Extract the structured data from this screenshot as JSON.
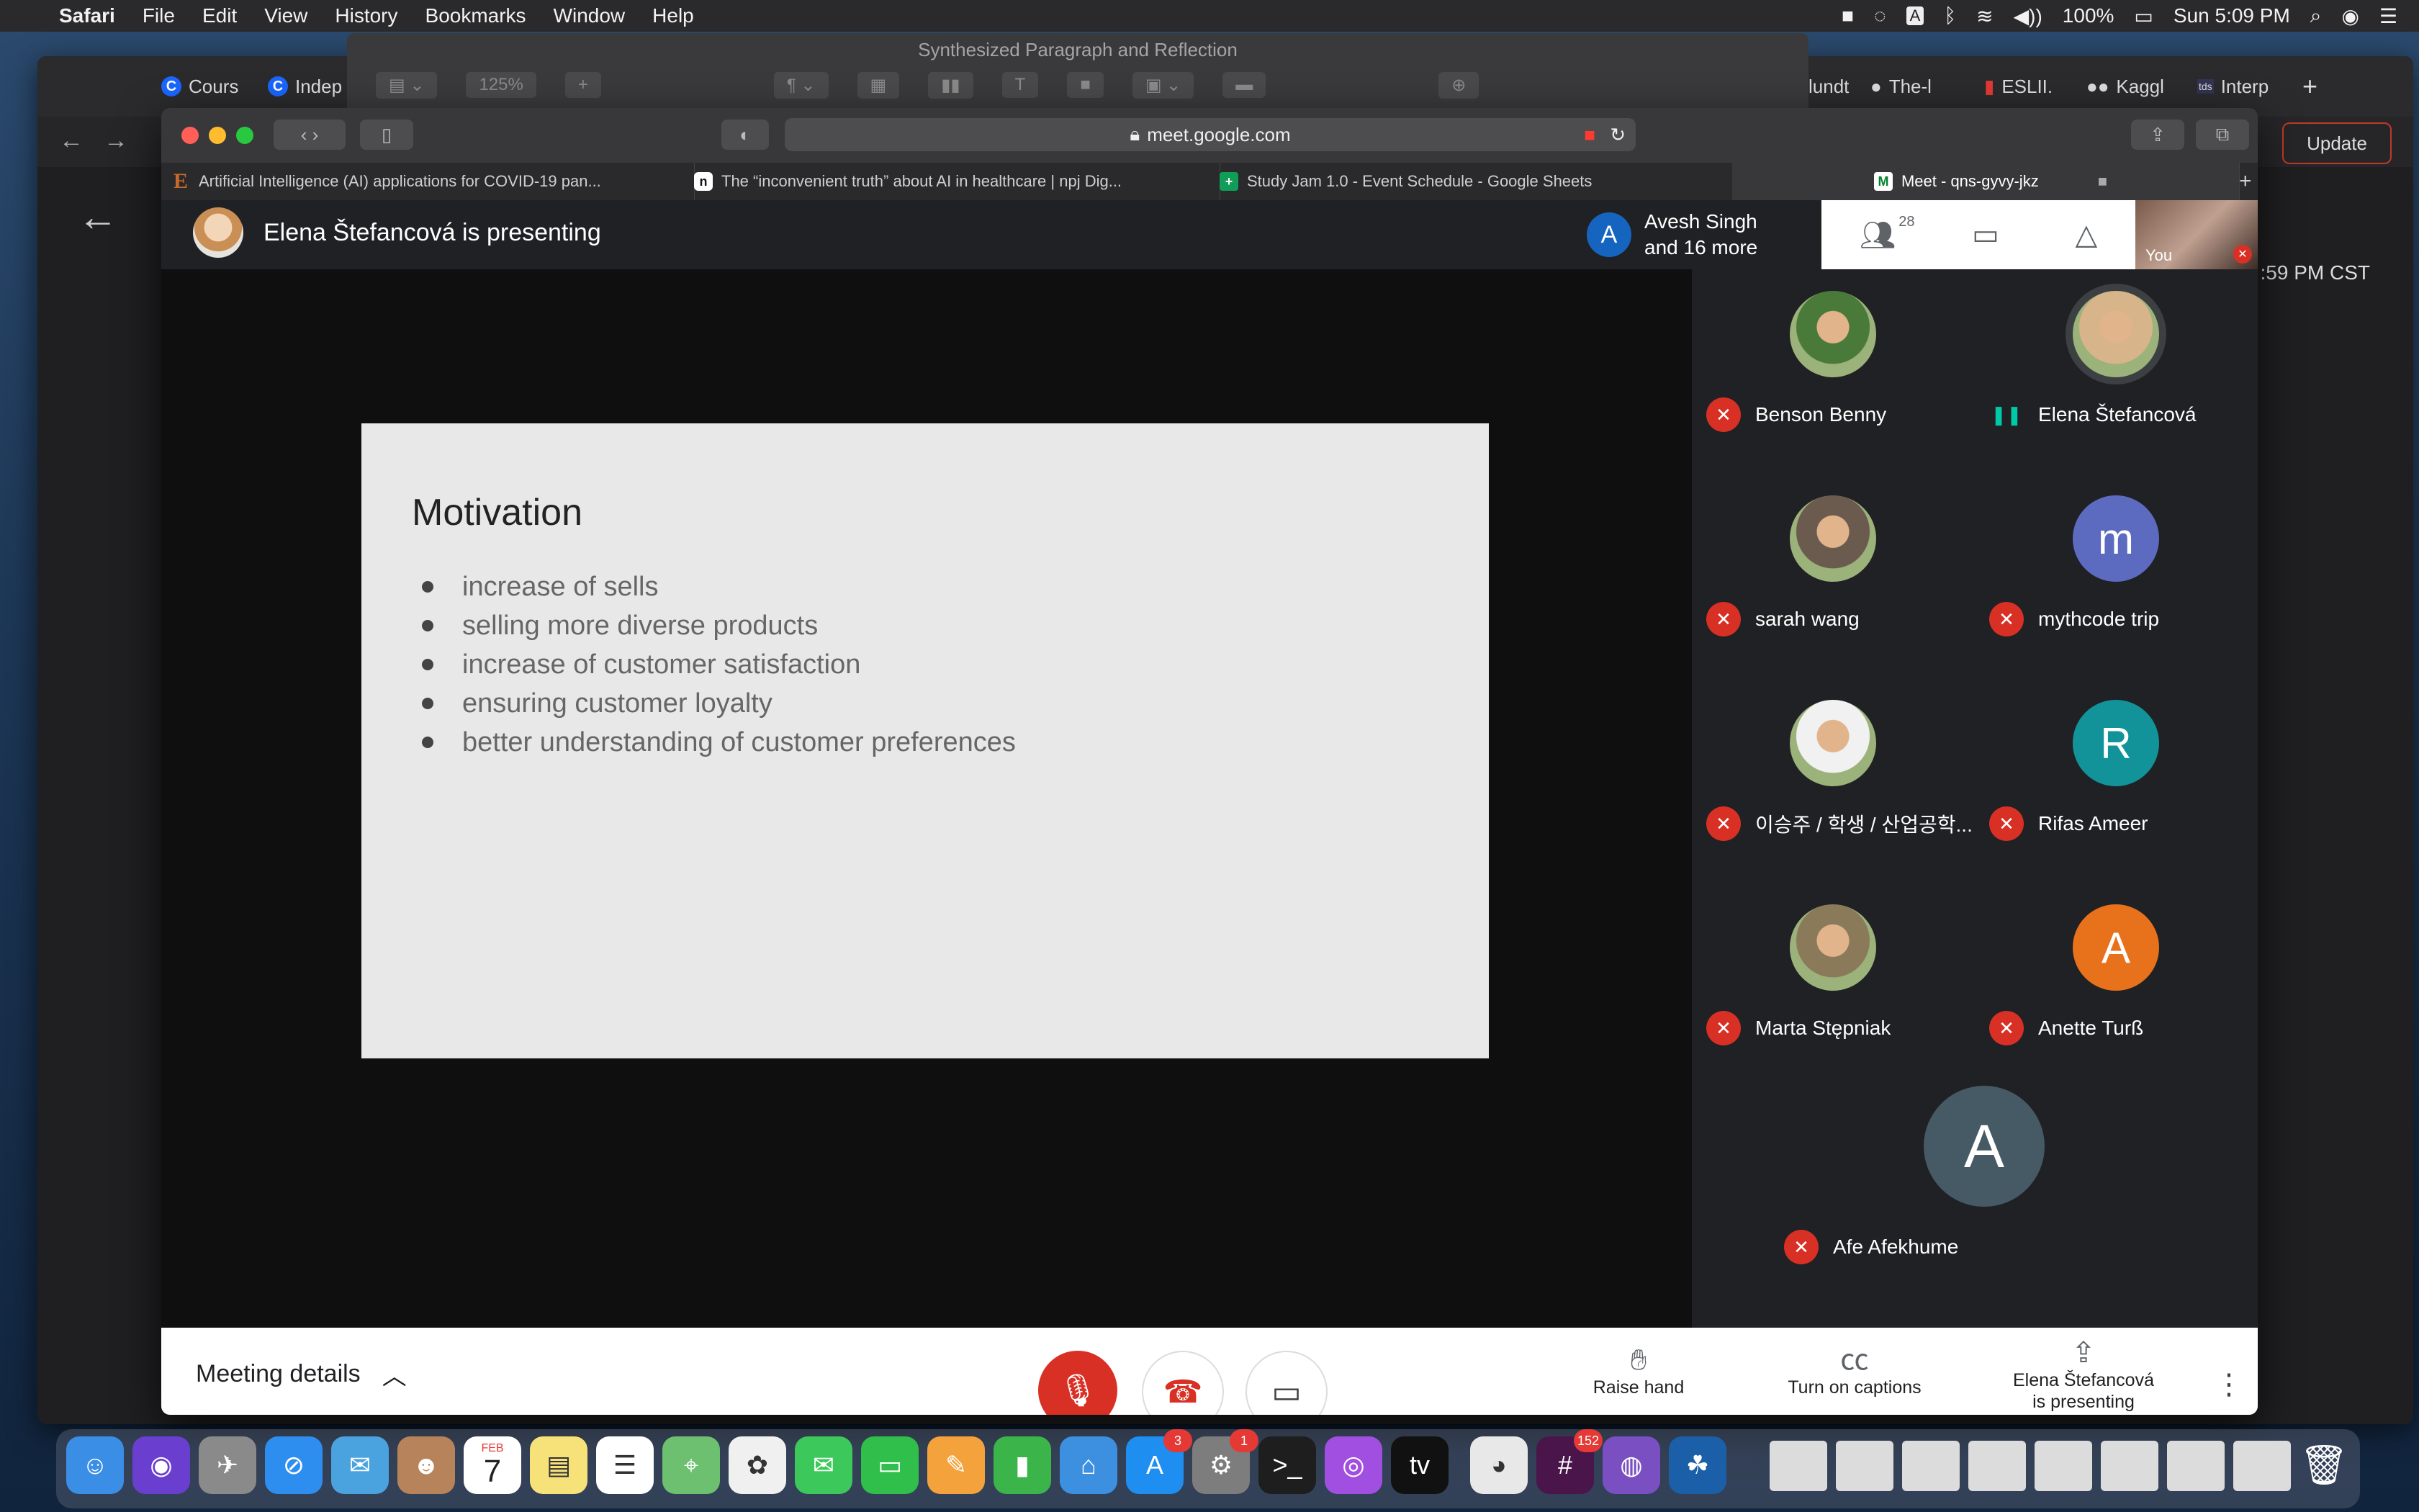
{
  "menubar": {
    "app": "Safari",
    "items": [
      "File",
      "Edit",
      "View",
      "History",
      "Bookmarks",
      "Window",
      "Help"
    ],
    "battery": "100%",
    "clock": "Sun 5:09 PM"
  },
  "background_window": {
    "tabs": [
      "Cours",
      "Indep",
      "lundt",
      "The-l",
      "ESLII.",
      "Kaggl",
      "Interp"
    ],
    "update_label": "Update",
    "time_text": ":59 PM CST"
  },
  "pages_window": {
    "title": "Synthesized Paragraph and Reflection",
    "zoom": "125%"
  },
  "safari": {
    "url": "meet.google.com",
    "tabs": [
      {
        "label": "Artificial Intelligence (AI) applications for COVID-19 pan...",
        "favicon": "E"
      },
      {
        "label": "The “inconvenient truth” about AI in healthcare | npj Dig...",
        "favicon": "n"
      },
      {
        "label": "Study Jam 1.0 - Event Schedule - Google Sheets",
        "favicon": "+"
      },
      {
        "label": "Meet - qns-gyvy-jkz",
        "favicon": "M"
      }
    ]
  },
  "meet": {
    "presenter_text": "Elena Štefancová is presenting",
    "people_summary": {
      "initial": "A",
      "line1": "Avesh Singh",
      "line2": "and 16 more"
    },
    "participant_count": "28",
    "self_label": "You",
    "slide": {
      "title": "Motivation",
      "bullets": [
        "increase of sells",
        "selling more diverse products",
        "increase of customer satisfaction",
        "ensuring customer loyalty",
        "better understanding of customer preferences"
      ]
    },
    "participants": [
      {
        "name": "Benson Benny",
        "muted": true,
        "avatar": "photo",
        "color": "#4a7a3a"
      },
      {
        "name": "Elena Štefancová",
        "muted": false,
        "avatar": "photo",
        "color": "#d8b48a"
      },
      {
        "name": "sarah wang",
        "muted": true,
        "avatar": "photo",
        "color": "#6b5a4e"
      },
      {
        "name": "mythcode trip",
        "muted": true,
        "avatar": "m",
        "color": "#5c6bc0"
      },
      {
        "name": "이승주 / 학생 / 산업공학...",
        "muted": true,
        "avatar": "photo",
        "color": "#f1f1f1"
      },
      {
        "name": "Rifas Ameer",
        "muted": true,
        "avatar": "R",
        "color": "#12939a"
      },
      {
        "name": "Marta Stępniak",
        "muted": true,
        "avatar": "photo",
        "color": "#8a7a5a"
      },
      {
        "name": "Anette Turß",
        "muted": true,
        "avatar": "A",
        "color": "#e8711c"
      }
    ],
    "lone_participant": {
      "name": "Afe Afekhume",
      "avatar": "A",
      "color": "#455a64"
    },
    "bottom": {
      "meeting_details": "Meeting details",
      "raise_hand": "Raise hand",
      "captions": "Turn on captions",
      "presenting_line1": "Elena Štefancová",
      "presenting_line2": "is presenting"
    }
  },
  "dock": {
    "badges": {
      "appstore": "3",
      "settings": "1",
      "slack": "152"
    },
    "calendar_month": "FEB",
    "calendar_day": "7"
  }
}
